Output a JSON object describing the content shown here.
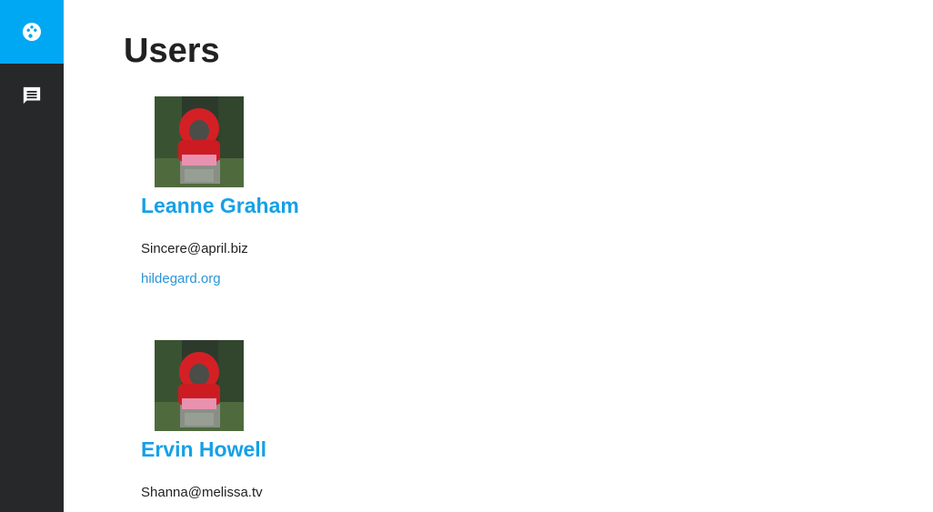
{
  "sidebar": {
    "items": [
      {
        "icon": "palette-icon",
        "active": true
      },
      {
        "icon": "message-icon",
        "active": false
      }
    ],
    "accent_color": "#00a8f4",
    "background_color": "#262829"
  },
  "page": {
    "title": "Users"
  },
  "users": [
    {
      "name": "Leanne Graham",
      "email": "Sincere@april.biz",
      "website": "hildegard.org"
    },
    {
      "name": "Ervin Howell",
      "email": "Shanna@melissa.tv",
      "website": ""
    }
  ],
  "colors": {
    "name_link": "#16a0e6",
    "website_link": "#2a95d8",
    "text": "#222222"
  }
}
